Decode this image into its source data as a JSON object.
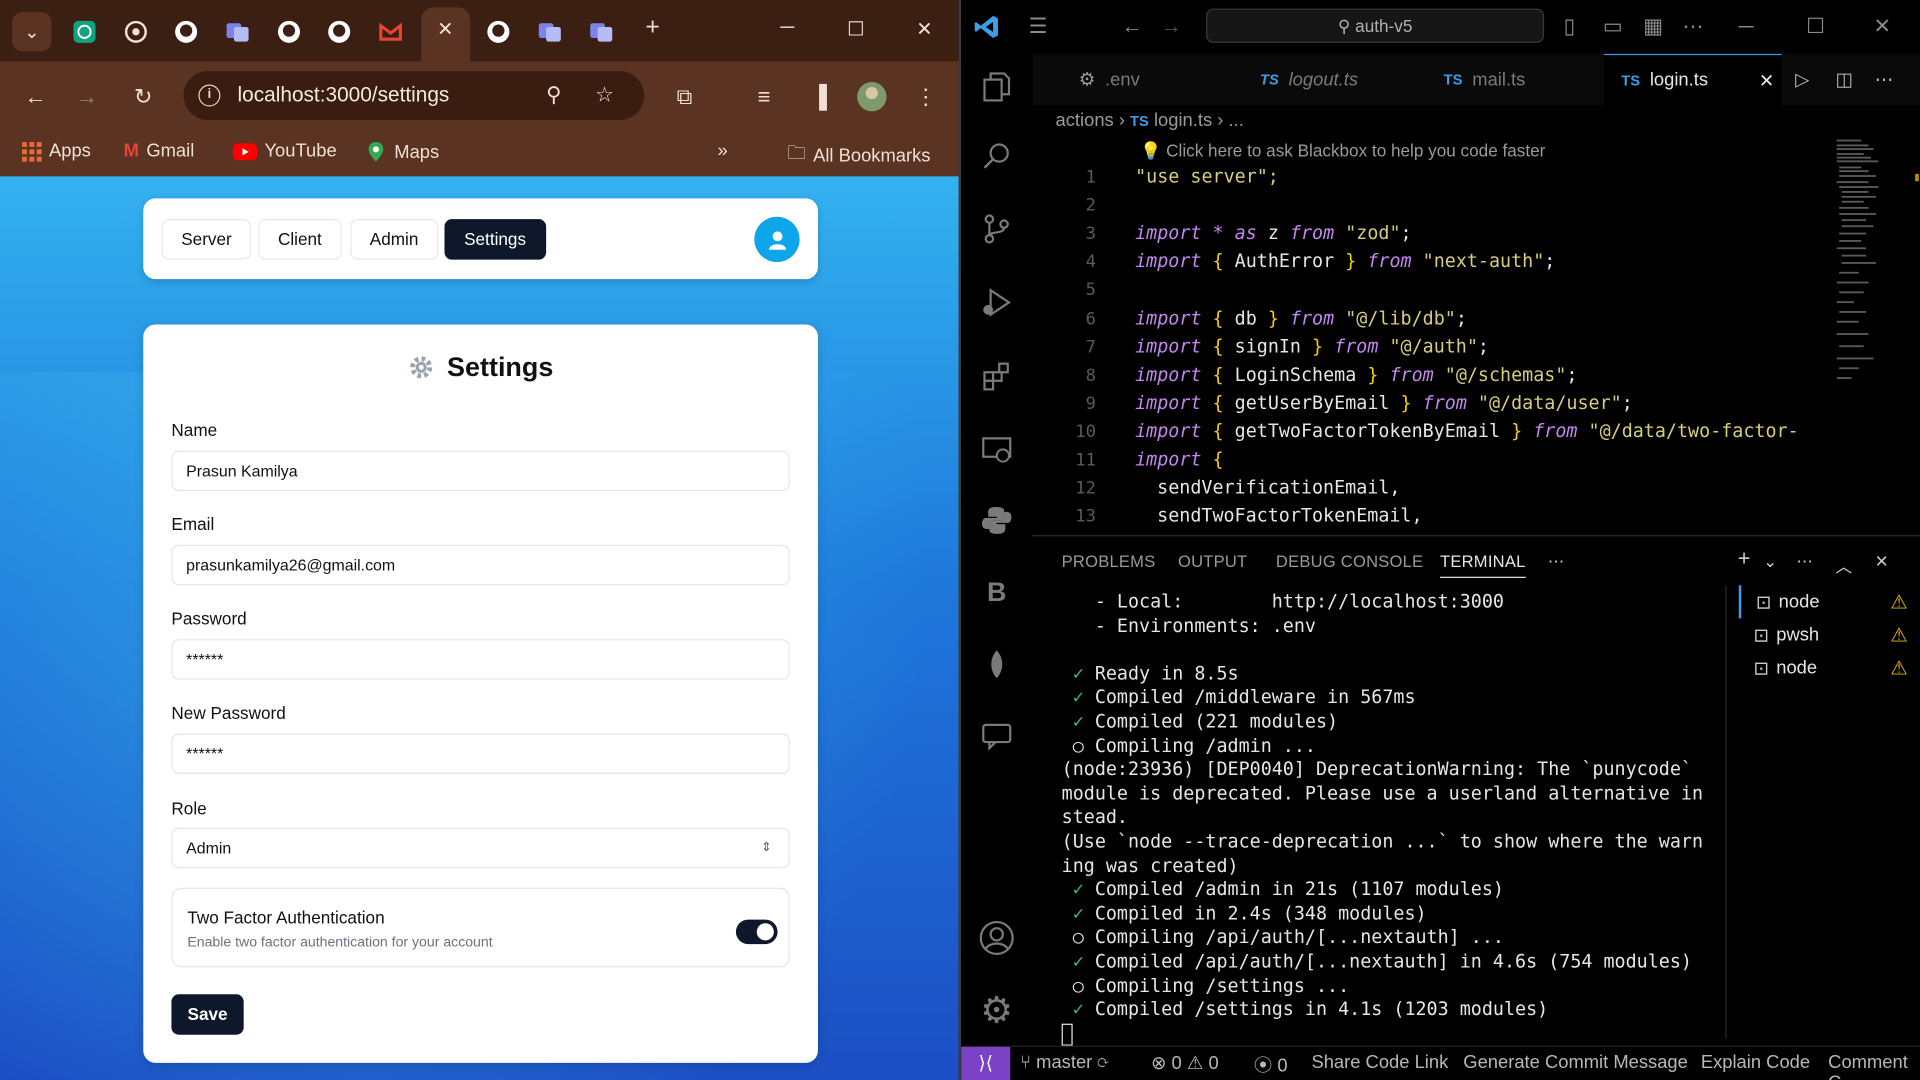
{
  "browser": {
    "url": "localhost:3000/settings",
    "bookmarks": [
      "Apps",
      "Gmail",
      "YouTube",
      "Maps"
    ],
    "all_bookmarks": "All Bookmarks",
    "nav": {
      "server": "Server",
      "client": "Client",
      "admin": "Admin",
      "settings": "Settings"
    },
    "settings": {
      "title": "Settings",
      "name_label": "Name",
      "name_value": "Prasun Kamilya",
      "email_label": "Email",
      "email_value": "prasunkamilya26@gmail.com",
      "password_label": "Password",
      "password_value": "******",
      "new_password_label": "New Password",
      "new_password_value": "******",
      "role_label": "Role",
      "role_value": "Admin",
      "tfa_title": "Two Factor Authentication",
      "tfa_desc": "Enable two factor authentication for your account",
      "tfa_enabled": true,
      "save": "Save"
    }
  },
  "vscode": {
    "search": "auth-v5",
    "tabs": [
      ".env",
      "logout.ts",
      "mail.ts",
      "login.ts"
    ],
    "breadcrumb": {
      "folder": "actions",
      "file": "login.ts",
      "more": "..."
    },
    "hint": "Click here to ask Blackbox to help you code faster",
    "line_numbers": [
      "1",
      "2",
      "3",
      "4",
      "5",
      "6",
      "7",
      "8",
      "9",
      "10",
      "11",
      "12",
      "13"
    ],
    "code": {
      "l1": "\"use server\";",
      "l3_mod": "\"zod\"",
      "l4_mod": "\"next-auth\"",
      "l6_mod": "\"@/lib/db\"",
      "l7_mod": "\"@/auth\"",
      "l8_mod": "\"@/schemas\"",
      "l9_mod": "\"@/data/user\"",
      "l10_mod": "\"@/data/two-factor-",
      "l12": "sendVerificationEmail,",
      "l13": "sendTwoFactorTokenEmail,"
    },
    "panel_tabs": [
      "PROBLEMS",
      "OUTPUT",
      "DEBUG CONSOLE",
      "TERMINAL"
    ],
    "terminal": [
      "   - Local:        http://localhost:3000",
      "   - Environments: .env",
      "",
      " ✓ Ready in 8.5s",
      " ✓ Compiled /middleware in 567ms",
      " ✓ Compiled (221 modules)",
      " ○ Compiling /admin ...",
      "(node:23936) [DEP0040] DeprecationWarning: The `punycode`",
      "module is deprecated. Please use a userland alternative in",
      "stead.",
      "(Use `node --trace-deprecation ...` to show where the warn",
      "ing was created)",
      " ✓ Compiled /admin in 21s (1107 modules)",
      " ✓ Compiled in 2.4s (348 modules)",
      " ○ Compiling /api/auth/[...nextauth] ...",
      " ✓ Compiled /api/auth/[...nextauth] in 4.6s (754 modules)",
      " ○ Compiling /settings ...",
      " ✓ Compiled /settings in 4.1s (1203 modules)"
    ],
    "terminals": [
      "node",
      "pwsh",
      "node"
    ],
    "status": {
      "branch": "master",
      "errors": "0",
      "warnings": "0",
      "ports": "0",
      "share": "Share Code Link",
      "commit": "Generate Commit Message",
      "explain": "Explain Code",
      "comment": "Comment C"
    }
  }
}
